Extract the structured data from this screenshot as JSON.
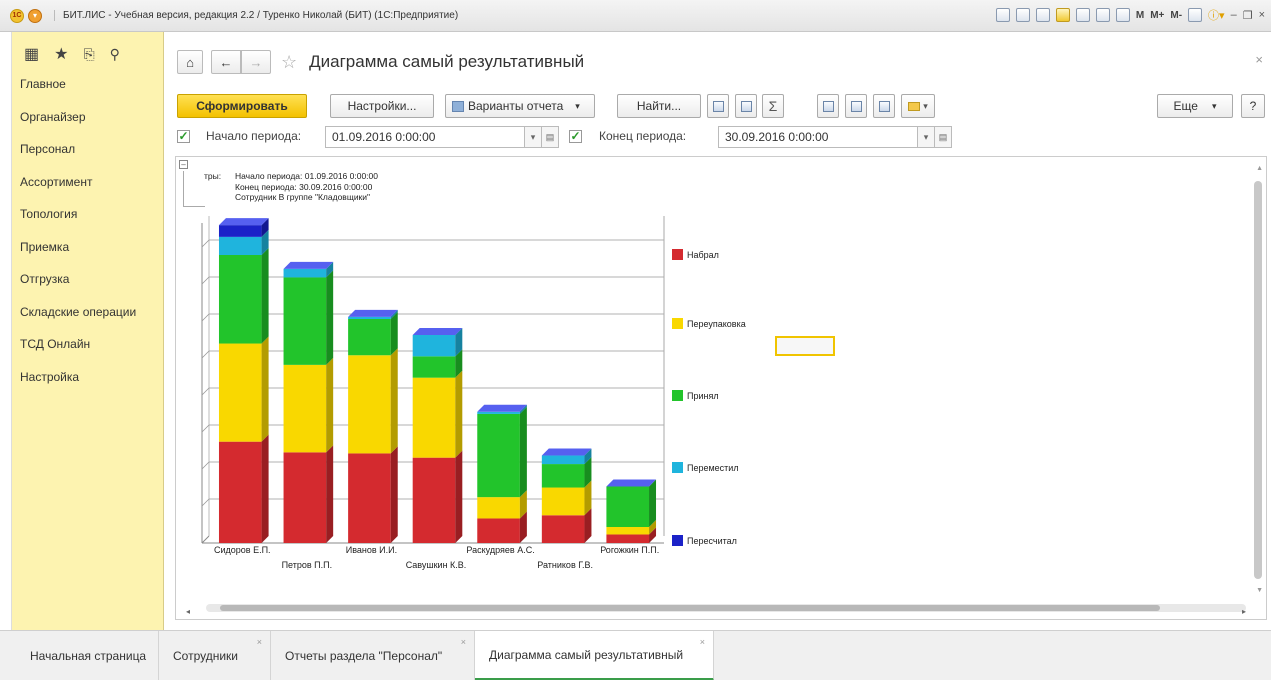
{
  "window": {
    "title": "БИТ.ЛИС - Учебная версия, редакция 2.2 / Туренко Николай (БИТ)  (1С:Предприятие)",
    "tools": [
      "M",
      "M+",
      "M-"
    ]
  },
  "sidebar": {
    "items": [
      {
        "label": "Главное"
      },
      {
        "label": "Органайзер"
      },
      {
        "label": "Персонал"
      },
      {
        "label": "Ассортимент"
      },
      {
        "label": "Топология"
      },
      {
        "label": "Приемка"
      },
      {
        "label": "Отгрузка"
      },
      {
        "label": "Складские операции"
      },
      {
        "label": "ТСД Онлайн"
      },
      {
        "label": "Настройка"
      }
    ]
  },
  "header": {
    "title": "Диаграмма самый результативный"
  },
  "toolbar": {
    "generate": "Сформировать",
    "settings": "Настройки...",
    "variants": "Варианты отчета",
    "find": "Найти...",
    "sum": "Σ",
    "more": "Еще",
    "help": "?"
  },
  "period": {
    "start_label": "Начало периода:",
    "start_value": "01.09.2016  0:00:00",
    "end_label": "Конец периода:",
    "end_value": "30.09.2016  0:00:00"
  },
  "report": {
    "params_prefix": "тры:",
    "params": [
      "Начало периода: 01.09.2016 0:00:00",
      "Конец периода: 30.09.2016 0:00:00",
      "Сотрудник В группе \"Кладовщики\""
    ]
  },
  "chart_data": {
    "type": "bar",
    "stacked": true,
    "categories": [
      "Сидоров Е.П.",
      "Петров П.П.",
      "Иванов И.И.",
      "Савушкин К.В.",
      "Раскудряев А.С.",
      "Ратников Г.В.",
      "Рогожкин П.П."
    ],
    "series": [
      {
        "name": "Набрал",
        "color": "#d42a2f",
        "values": [
          95,
          85,
          84,
          80,
          23,
          26,
          8
        ]
      },
      {
        "name": "Переупаковка",
        "color": "#f9d800",
        "values": [
          92,
          82,
          92,
          75,
          20,
          26,
          7
        ]
      },
      {
        "name": "Принял",
        "color": "#22c42b",
        "values": [
          83,
          82,
          34,
          20,
          78,
          22,
          38
        ]
      },
      {
        "name": "Переместил",
        "color": "#1fb4dd",
        "values": [
          17,
          8,
          2,
          20,
          2,
          8,
          0
        ]
      },
      {
        "name": "Пересчитал",
        "color": "#1b22c8",
        "values": [
          11,
          0,
          0,
          0,
          0,
          0,
          0
        ]
      }
    ],
    "legend_position": "right",
    "grid": true
  },
  "tabs": [
    {
      "label": "Начальная страница"
    },
    {
      "label": "Сотрудники"
    },
    {
      "label": "Отчеты раздела \"Персонал\""
    },
    {
      "label": "Диаграмма самый результативный"
    }
  ]
}
